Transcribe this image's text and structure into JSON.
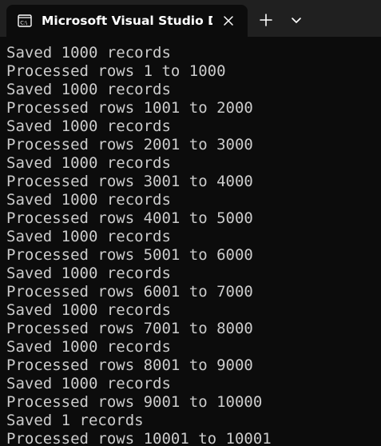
{
  "tab": {
    "title": "Microsoft Visual Studio Debug Console"
  },
  "icons": {
    "tab_icon": "console-app-icon",
    "close": "close-icon",
    "new_tab": "plus-icon",
    "dropdown": "chevron-down-icon"
  },
  "colors": {
    "titlebar": "#202020",
    "background": "#0c0c0c",
    "text": "#cccccc"
  },
  "console": {
    "lines": [
      "Saved 1000 records",
      "Processed rows 1 to 1000",
      "Saved 1000 records",
      "Processed rows 1001 to 2000",
      "Saved 1000 records",
      "Processed rows 2001 to 3000",
      "Saved 1000 records",
      "Processed rows 3001 to 4000",
      "Saved 1000 records",
      "Processed rows 4001 to 5000",
      "Saved 1000 records",
      "Processed rows 5001 to 6000",
      "Saved 1000 records",
      "Processed rows 6001 to 7000",
      "Saved 1000 records",
      "Processed rows 7001 to 8000",
      "Saved 1000 records",
      "Processed rows 8001 to 9000",
      "Saved 1000 records",
      "Processed rows 9001 to 10000",
      "Saved 1 records",
      "Processed rows 10001 to 10001"
    ]
  }
}
